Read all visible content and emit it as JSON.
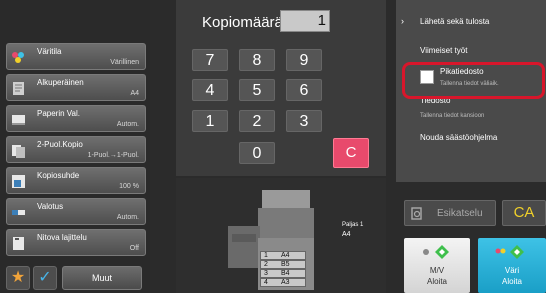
{
  "settings": [
    {
      "label": "Väritila",
      "value": "Värillinen",
      "icon": "color-mode-icon"
    },
    {
      "label": "Alkuperäinen",
      "value": "A4",
      "icon": "original-icon"
    },
    {
      "label": "Paperin Val.",
      "value": "Autom.",
      "icon": "paper-select-icon"
    },
    {
      "label": "2-Puol.Kopio",
      "value": "1-Puol.→1-Puol.",
      "icon": "duplex-icon"
    },
    {
      "label": "Kopiosuhde",
      "value": "100 %",
      "icon": "ratio-icon"
    },
    {
      "label": "Valotus",
      "value": "Autom.",
      "icon": "exposure-icon"
    },
    {
      "label": "Nitova lajittelu",
      "value": "Off",
      "icon": "staple-sort-icon"
    }
  ],
  "bottom_left": {
    "more_label": "Muut"
  },
  "keypad": {
    "title": "Kopiomäärä",
    "count": "1",
    "keys": [
      "7",
      "8",
      "9",
      "4",
      "5",
      "6",
      "1",
      "2",
      "3",
      "0"
    ],
    "clear": "C"
  },
  "preview": {
    "paper_label": "Paljas 1",
    "paper_size": "A4",
    "trays": [
      {
        "num": "1",
        "size": "A4"
      },
      {
        "num": "2",
        "size": "B5"
      },
      {
        "num": "3",
        "size": "B4"
      },
      {
        "num": "4",
        "size": "A3"
      }
    ]
  },
  "right_menu": {
    "send_and_print": "Lähetä sekä tulosta",
    "recent_jobs": "Viimeiset työt",
    "quick_file": "Pikatiedosto",
    "quick_file_sub": "Tallenna tiedot väliaik.",
    "file": "Tiedosto",
    "file_sub": "Tallenna tiedot kansioon",
    "recall_program": "Nouda säästöohjelma"
  },
  "actions": {
    "preview": "Esikatselu",
    "ca": "CA",
    "bw_top": "M/V",
    "bw_bottom": "Aloita",
    "color_top": "Väri",
    "color_bottom": "Aloita"
  },
  "colors": {
    "highlight": "#d8162b",
    "clear_key": "#e84a6c",
    "start_color": "#1a9fc7",
    "ca_text": "#f0d02a"
  }
}
